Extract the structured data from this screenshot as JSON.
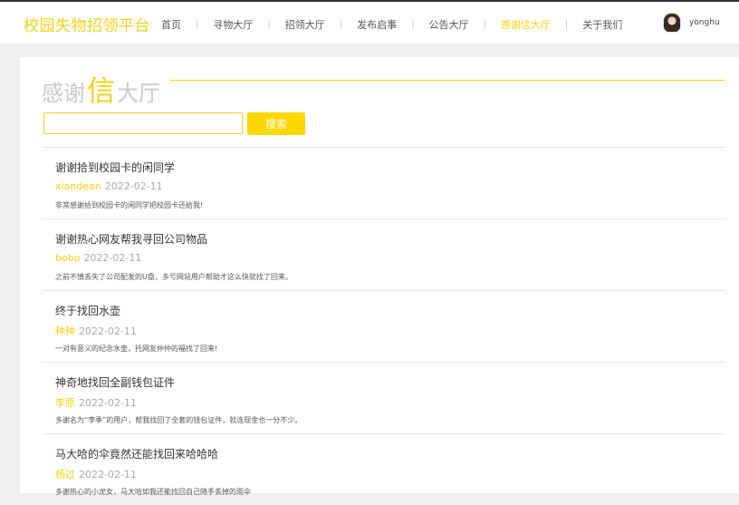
{
  "header": {
    "brand": "校园失物招领平台",
    "nav": [
      {
        "label": "首页",
        "active": false
      },
      {
        "label": "寻物大厅",
        "active": false
      },
      {
        "label": "招领大厅",
        "active": false
      },
      {
        "label": "发布启事",
        "active": false
      },
      {
        "label": "公告大厅",
        "active": false
      },
      {
        "label": "感谢信大厅",
        "active": true
      },
      {
        "label": "关于我们",
        "active": false
      }
    ],
    "user": {
      "name": "yonghu"
    }
  },
  "section": {
    "title_pre": "感谢",
    "title_big": "信",
    "title_post": "大厅"
  },
  "search": {
    "value": "",
    "placeholder": "",
    "button_label": "搜索"
  },
  "letters": [
    {
      "title": "谢谢拾到校园卡的闲同学",
      "user": "xiandean",
      "date": "2022-02-11",
      "body": "非常感谢拾到校园卡的闲同学把校园卡还给我!"
    },
    {
      "title": "谢谢热心网友帮我寻回公司物品",
      "user": "bobo",
      "date": "2022-02-11",
      "body": "之前不慎丢失了公司配发的U盘，多亏网站用户帮助才这么快就找了回来。"
    },
    {
      "title": "终于找回水壶",
      "user": "种种",
      "date": "2022-02-11",
      "body": "一对有意义的纪念水壶，托网友仲仲的福找了回来!"
    },
    {
      "title": "神奇地找回全副钱包证件",
      "user": "李原",
      "date": "2022-02-11",
      "body": "多谢名为“李季”的用户，帮我找回了全套的钱包证件，就连现金也一分不少。"
    },
    {
      "title": "马大哈的伞竟然还能找回来哈哈哈",
      "user": "杨过",
      "date": "2022-02-11",
      "body": "多谢热心的小龙女，马大哈如我还能找回自己随手丢掉的雨伞"
    }
  ],
  "colors": {
    "accent": "#f5d210",
    "button": "#ffd700",
    "page_bg": "#efefef"
  }
}
